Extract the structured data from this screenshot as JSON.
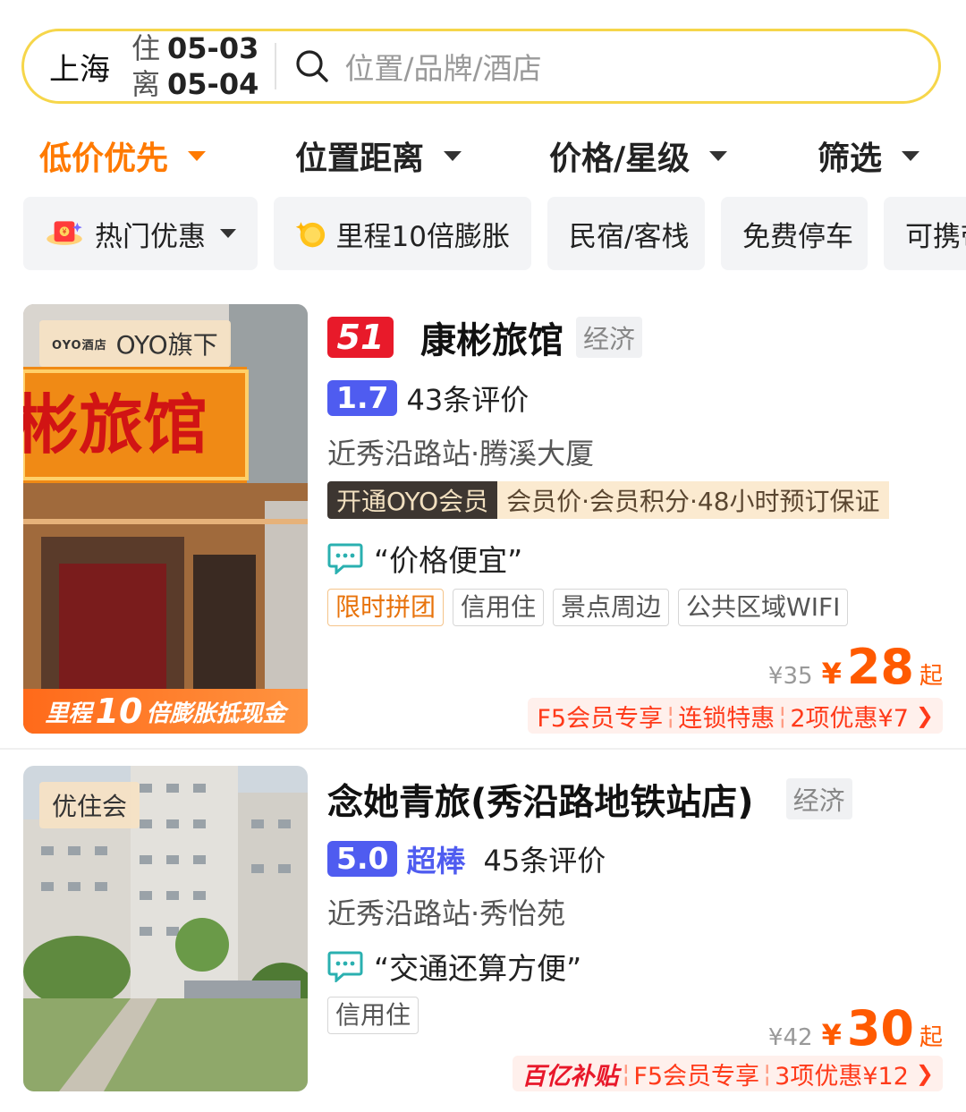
{
  "search": {
    "city": "上海",
    "checkin_label": "住",
    "checkin": "05-03",
    "checkout_label": "离",
    "checkout": "05-04",
    "placeholder": "位置/品牌/酒店"
  },
  "sort": [
    {
      "label": "低价优先",
      "active": true
    },
    {
      "label": "位置距离",
      "active": false
    },
    {
      "label": "价格/星级",
      "active": false
    },
    {
      "label": "筛选",
      "active": false
    }
  ],
  "chips": [
    {
      "label": "热门优惠"
    },
    {
      "label": "里程10倍膨胀"
    },
    {
      "label": "民宿/客栈"
    },
    {
      "label": "免费停车"
    },
    {
      "label": "可携带"
    }
  ],
  "hotels": [
    {
      "rank": "51",
      "name": "康彬旅馆",
      "level": "经济",
      "score": "1.7",
      "score_word": "",
      "reviews": "43条评价",
      "location": "近秀沿路站·腾溪大厦",
      "member_dark": "开通OYO会员",
      "member_light": "会员价·会员积分·48小时预订保证",
      "quote": "“价格便宜”",
      "tags": [
        "限时拼团",
        "信用住",
        "景点周边",
        "公共区域WIFI"
      ],
      "orig_price": "¥35",
      "currency": "¥",
      "price": "28",
      "price_suffix": "起",
      "deal_parts": [
        "F5会员专享",
        "连锁特惠",
        "2项优惠¥7"
      ],
      "image_badge_logo": "OYO酒店",
      "image_badge": "OYO旗下",
      "image_sign": "彬旅馆",
      "image_banner_pre": "里程",
      "image_banner_num": "10",
      "image_banner_post": "倍膨胀抵现金"
    },
    {
      "rank": "",
      "name": "念她青旅(秀沿路地铁站店)",
      "level": "经济",
      "score": "5.0",
      "score_word": "超棒",
      "reviews": "45条评价",
      "location": "近秀沿路站·秀怡苑",
      "quote": "“交通还算方便”",
      "tags": [
        "信用住"
      ],
      "orig_price": "¥42",
      "currency": "¥",
      "price": "30",
      "price_suffix": "起",
      "deal_prefix": "百亿补贴",
      "deal_parts": [
        "F5会员专享",
        "3项优惠¥12"
      ],
      "image_badge": "优住会"
    }
  ],
  "colors": {
    "accent": "#ff7a00",
    "price": "#ff5a00",
    "score": "#4f5cf0",
    "search_border": "#f6d64a"
  }
}
